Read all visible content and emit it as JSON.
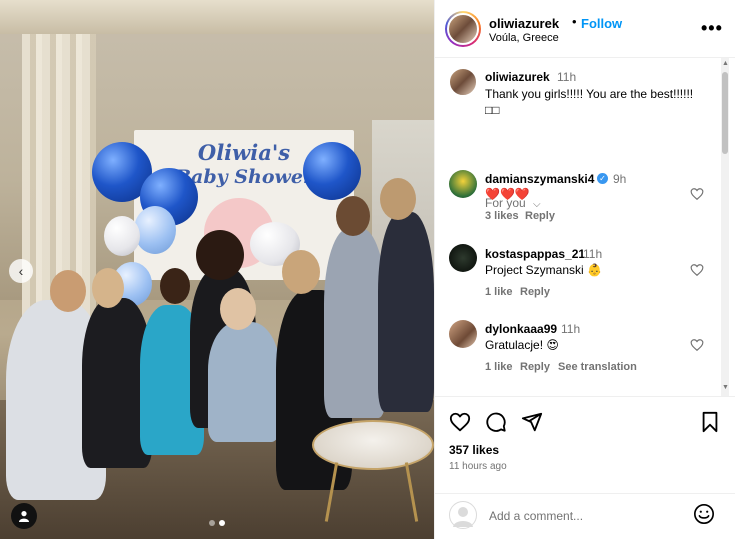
{
  "post": {
    "username": "oliwiazurek",
    "follow_label": "Follow",
    "separator": "•",
    "location": "Voúla, Greece",
    "more_label": "•••",
    "banner_line1": "Oliwia's",
    "banner_line2": "Baby Shower"
  },
  "caption": {
    "username": "oliwiazurek",
    "time": "11h",
    "text": "Thank you girls!!!!! You are the best!!!!!! □□",
    "for_you_label": "For you",
    "for_you_chevron": "⌵"
  },
  "comments": [
    {
      "username": "damianszymanski4",
      "verified": true,
      "verified_glyph": "✓",
      "time": "9h",
      "text": "❤️❤️❤️",
      "likes": "3 likes",
      "reply_label": "Reply"
    },
    {
      "username": "kostaspappas_21",
      "verified": false,
      "time": "11h",
      "text": "Project Szymanski 👶",
      "likes": "1 like",
      "reply_label": "Reply"
    },
    {
      "username": "dylonkaaa99",
      "verified": false,
      "time": "11h",
      "text": "Gratulacje! 😍",
      "likes": "1 like",
      "reply_label": "Reply",
      "translation_label": "See translation"
    }
  ],
  "stats": {
    "likes": "357 likes",
    "time_ago": "11 hours ago"
  },
  "add_comment": {
    "placeholder": "Add a comment..."
  },
  "carousel": {
    "slide_count": 2,
    "current_slide": 2,
    "prev_arrow": "‹"
  },
  "colors": {
    "link_blue": "#0095f6",
    "muted_text": "#737373",
    "heart_red": "#ed4956",
    "border": "#efefef"
  },
  "icons": [
    "chevron-left-icon",
    "user-tag-icon",
    "more-icon",
    "heart-icon",
    "comment-icon",
    "share-icon",
    "bookmark-icon",
    "emoji-icon",
    "verified-badge-icon"
  ]
}
